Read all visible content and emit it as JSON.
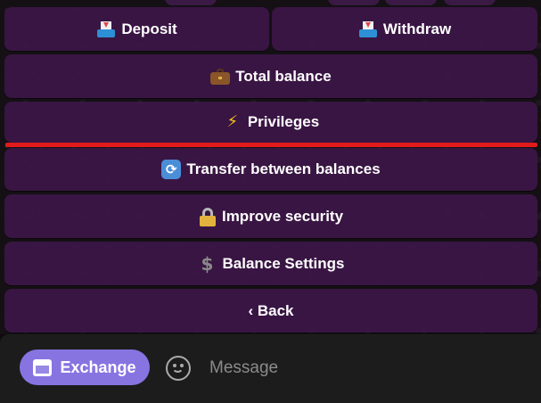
{
  "keyboard": {
    "deposit": {
      "icon": "inbox-tray-icon",
      "label": "Deposit"
    },
    "withdraw": {
      "icon": "inbox-tray-icon",
      "label": "Withdraw"
    },
    "total_balance": {
      "icon": "briefcase-icon",
      "label": "Total balance"
    },
    "privileges": {
      "icon": "lightning-icon",
      "label": "Privileges",
      "glyph": "⚡"
    },
    "transfer": {
      "icon": "sync-arrows-icon",
      "label": "Transfer between balances",
      "glyph": "🔄"
    },
    "security": {
      "icon": "lock-icon",
      "label": "Improve security"
    },
    "settings": {
      "icon": "dollar-sign-icon",
      "label": "Balance Settings",
      "glyph": "$"
    },
    "back": {
      "label": "‹ Back"
    }
  },
  "highlight_color": "#e11b1b",
  "accent_color": "#8774e1",
  "composer": {
    "exchange_label": "Exchange",
    "emoji_icon": "smile-icon",
    "message_placeholder": "Message"
  }
}
